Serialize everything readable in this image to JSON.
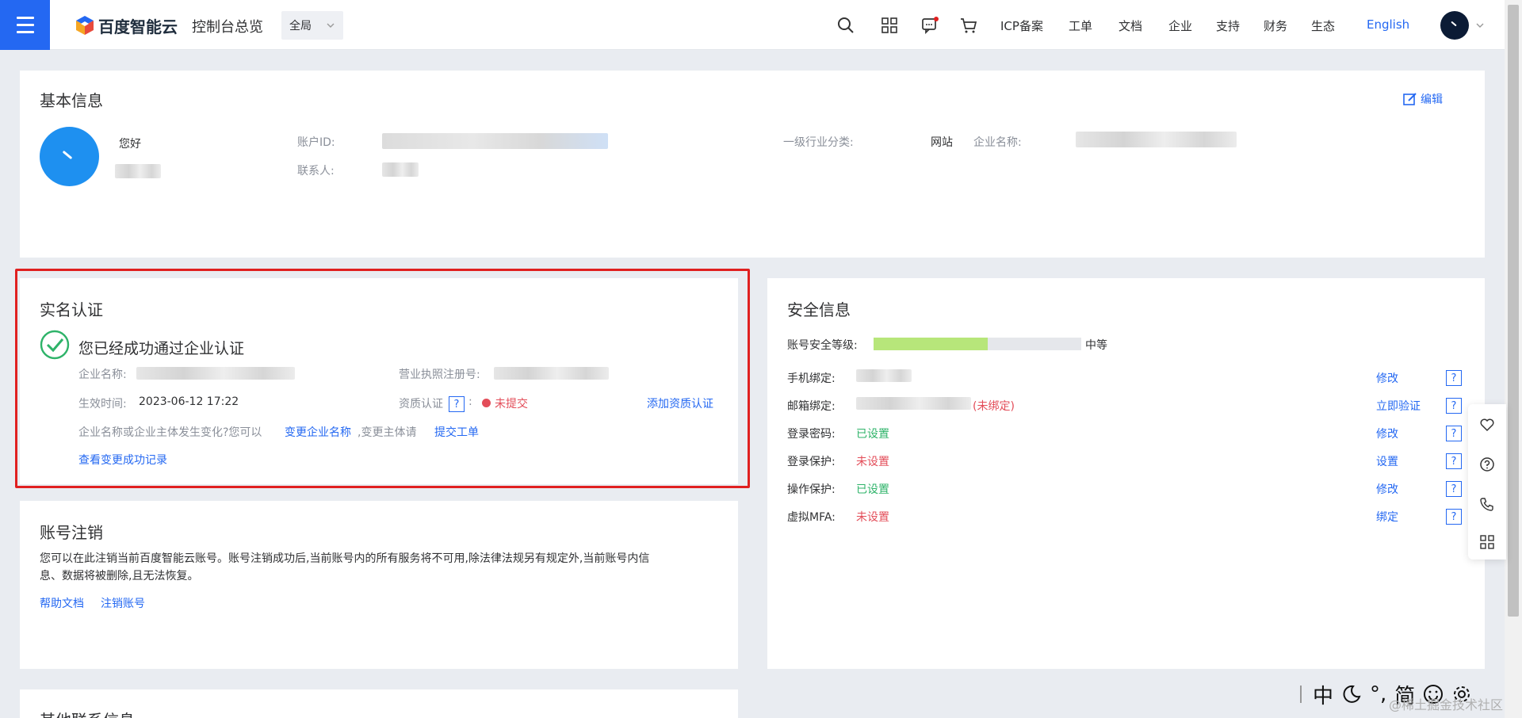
{
  "header": {
    "brand": "百度智能云",
    "console_title": "控制台总览",
    "region": "全局",
    "nav_items": [
      "ICP备案",
      "工单",
      "文档",
      "企业",
      "支持",
      "财务",
      "生态"
    ],
    "language": "English"
  },
  "basic_info": {
    "title": "基本信息",
    "edit_label": "编辑",
    "greeting": "您好",
    "account_id_label": "账户ID:",
    "contact_label": "联系人:",
    "industry_label": "一级行业分类:",
    "industry_value": "网站",
    "company_name_label": "企业名称:"
  },
  "verification": {
    "title": "实名认证",
    "status": "您已经成功通过企业认证",
    "company_name_label": "企业名称:",
    "license_label": "营业执照注册号:",
    "effective_label": "生效时间:",
    "effective_value": "2023-06-12 17:22",
    "qualification_label": "资质认证",
    "qualification_help": "?",
    "qualification_colon": ":",
    "qualification_status": "未提交",
    "add_qualification": "添加资质认证",
    "change_text_1": "企业名称或企业主体发生变化?您可以",
    "change_name_link": "变更企业名称",
    "change_text_2": ",变更主体请",
    "submit_ticket_link": "提交工单",
    "view_records_link": "查看变更成功记录"
  },
  "cancel_account": {
    "title": "账号注销",
    "desc_line1": "您可以在此注销当前百度智能云账号。账号注销成功后,当前账号内的所有服务将不可用,除法律法规另有规定外,当前账号内信",
    "desc_line2": "息、数据将被删除,且无法恢复。",
    "help_link": "帮助文档",
    "cancel_link": "注销账号"
  },
  "security": {
    "title": "安全信息",
    "level_label": "账号安全等级:",
    "level_value": "中等",
    "level_fraction": 0.55,
    "rows": [
      {
        "label": "手机绑定:",
        "value": "",
        "action": "修改",
        "help": "?"
      },
      {
        "label": "邮箱绑定:",
        "value": "(未绑定)",
        "action": "立即验证",
        "help": "?"
      },
      {
        "label": "登录密码:",
        "value": "已设置",
        "action": "修改",
        "help": "?"
      },
      {
        "label": "登录保护:",
        "value": "未设置",
        "action": "设置",
        "help": "?"
      },
      {
        "label": "操作保护:",
        "value": "已设置",
        "action": "修改",
        "help": "?"
      },
      {
        "label": "虚拟MFA:",
        "value": "未设置",
        "action": "绑定",
        "help": "?"
      }
    ]
  },
  "other_contact": {
    "title": "其他联系信息"
  },
  "ime": {
    "items": [
      "中",
      "°,",
      "简"
    ]
  },
  "watermark": "@稀土掘金技术社区",
  "colors": {
    "primary": "#2468f2",
    "success": "#2eb369",
    "danger": "#e34d59",
    "security_bar": "#b7e67a"
  }
}
